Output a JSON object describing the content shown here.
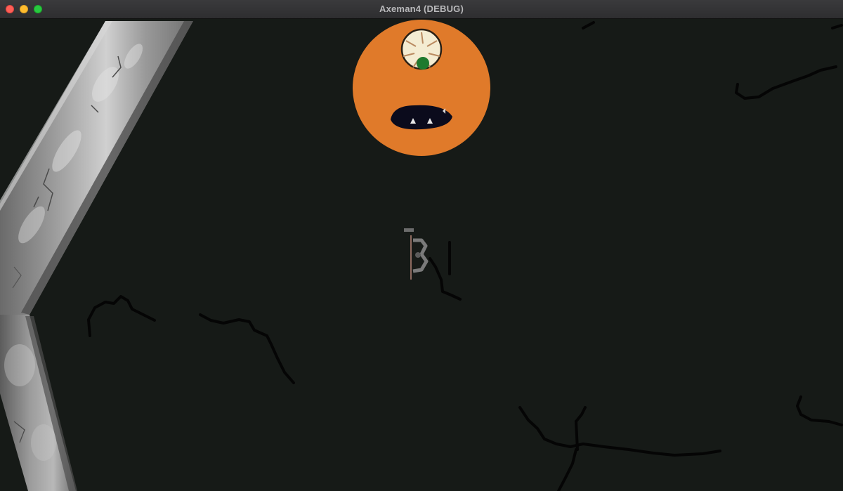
{
  "window": {
    "title": "Axeman4 (DEBUG)"
  },
  "controls": {
    "close": "close-icon",
    "minimize": "minimize-icon",
    "maximize": "maximize-icon"
  },
  "colors": {
    "background": "#161a17",
    "monster_body": "#e07a2a",
    "wall": "#8a8a8a",
    "crack": "#050505"
  }
}
